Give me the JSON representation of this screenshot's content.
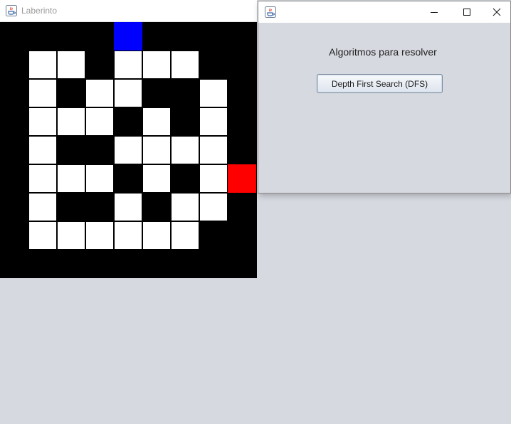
{
  "maze_window": {
    "title": "Laberinto",
    "icon": "java-icon",
    "grid": {
      "rows": 9,
      "cols": 9,
      "cells": [
        "####S####",
        "#..#...##",
        "#.#..##.#",
        "#...#.#.#",
        "#.##....#",
        "#...#.#.G",
        "#.##.#..#",
        "#......##",
        "#########"
      ],
      "legend": {
        "#": "wall",
        ".": "open",
        "S": "start",
        "G": "goal"
      },
      "colors": {
        "wall": "#000000",
        "open": "#ffffff",
        "start": "#0000ff",
        "goal": "#ff0000"
      }
    }
  },
  "solver_window": {
    "title": "",
    "icon": "java-icon",
    "controls": [
      "minimize-icon",
      "maximize-icon",
      "close-icon"
    ],
    "heading": "Algoritmos para resolver",
    "dfs_button_label": "Depth First Search (DFS)"
  }
}
